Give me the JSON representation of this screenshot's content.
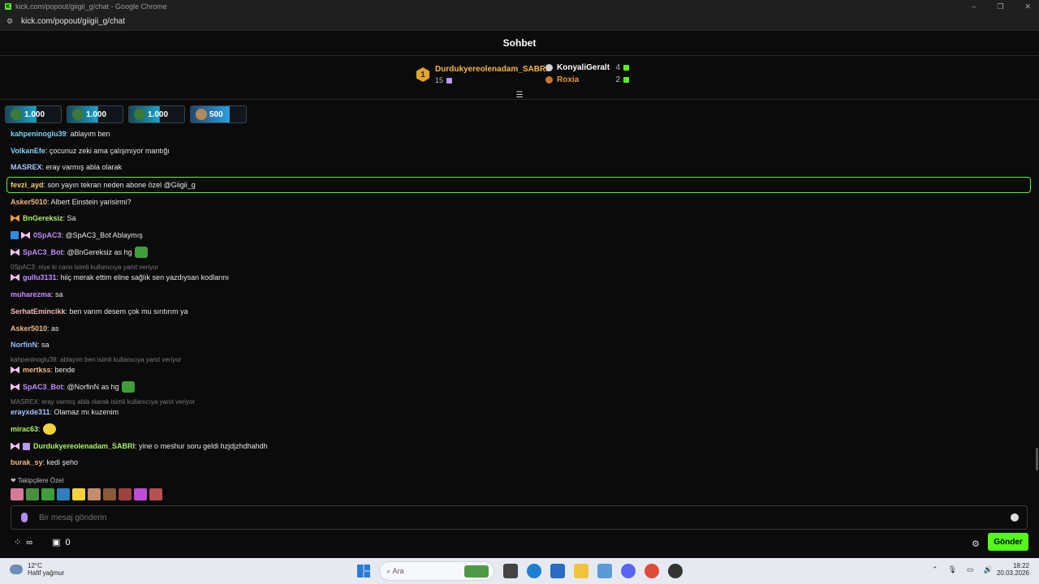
{
  "window": {
    "title": "kick.com/popout/giigii_g/chat - Google Chrome",
    "url": "kick.com/popout/giigii_g/chat",
    "controls": [
      "–",
      "❐",
      "✕"
    ]
  },
  "chat": {
    "title": "Sohbet",
    "leaderboard": {
      "first": {
        "rank": "1",
        "name": "Durdukyereolenadam_SABRI",
        "count": "15"
      },
      "second": {
        "name": "KonyaliGeralt",
        "count": "4"
      },
      "third": {
        "name": "Roxia",
        "count": "2"
      }
    },
    "pinned_gifts": [
      {
        "amount": "1.000"
      },
      {
        "amount": "1.000"
      },
      {
        "amount": "1.000"
      },
      {
        "amount": "500"
      }
    ],
    "messages": [
      {
        "user": "kahpeninoglu39",
        "text": ": ablayım ben",
        "color": "#7fd1f5"
      },
      {
        "user": "VolkanEfe",
        "text": ": çocunuz zeki ama çalışmıyor mantığı",
        "color": "#7fd1f5"
      },
      {
        "user": "MASREX",
        "text": ": eray varmış abla olarak",
        "color": "#a7c4ff"
      },
      {
        "user": "fevzi_ayd",
        "text": ": son yayın tekrarı neden abone özel @Giigii_g",
        "color": "#f5d36b"
      },
      {
        "user": "Asker5010",
        "text": ": Albert Einstein yarisirmi?",
        "color": "#f5b77f"
      },
      {
        "user": "BnGereksiz",
        "text": ": Sa",
        "color": "#a9f25f"
      },
      {
        "user": "0SpAC3",
        "text": ": @SpAC3_Bot Ablaymış",
        "color": "#c38cff"
      },
      {
        "user": "SpAC3_Bot",
        "text": ": @BnGereksiz as hg",
        "color": "#c38cff"
      },
      {
        "reply": "0SpAC3: niye ki cano isimli kullanıcıya yanıt veriyor"
      },
      {
        "user": "gullu3131",
        "text": ": hiiç merak ettim eline sağlık sen yazdıysan kodlarını",
        "color": "#c38cff"
      },
      {
        "user": "muharezma",
        "text": ": sa",
        "color": "#c38cff"
      },
      {
        "user": "SerhatEmincikk",
        "text": ": ben varım desem çok mu sırıtırım ya",
        "color": "#f5b7b7"
      },
      {
        "user": "Asker5010",
        "text": ": as",
        "color": "#f5b77f"
      },
      {
        "user": "NorfinN",
        "text": ": sa",
        "color": "#8fc0ff"
      },
      {
        "reply": "kahpeninoglu39: ablayım ben isimli kullanıcıya yanıt veriyor"
      },
      {
        "user": "mertkss",
        "text": ": bende",
        "color": "#f5b77f"
      },
      {
        "user": "SpAC3_Bot",
        "text": ": @NorfinN as hg",
        "color": "#c38cff"
      },
      {
        "reply": "MASREX: eray varmış abla olarak isimli kullanıcıya yanıt veriyor"
      },
      {
        "user": "erayxde311",
        "text": ": Olamaz mı kuzenim",
        "color": "#a7c4ff"
      },
      {
        "user": "mirac63",
        "text": ":",
        "color": "#a9f25f"
      },
      {
        "user": "Durdukyereolenadam_SABRI",
        "text": ": yine o meshur soru geldi hzjdjzhdhahdh",
        "color": "#a9f25f"
      },
      {
        "user": "burak_sy",
        "text": ": kedi şeho",
        "color": "#f5b77f"
      }
    ],
    "follower_label": "Takipçilere Özel",
    "input_placeholder": "Bir mesaj gönderin",
    "bottom": {
      "infinity": "∞",
      "store_count": "0",
      "send_label": "Gönder"
    }
  },
  "taskbar": {
    "temp": "12°C",
    "weather": "Hafif yağmur",
    "search": "Ara",
    "time": "18:22",
    "date": "20.03.2026"
  },
  "colors": {
    "accent": "#53fc18",
    "gold": "#f5b745"
  }
}
